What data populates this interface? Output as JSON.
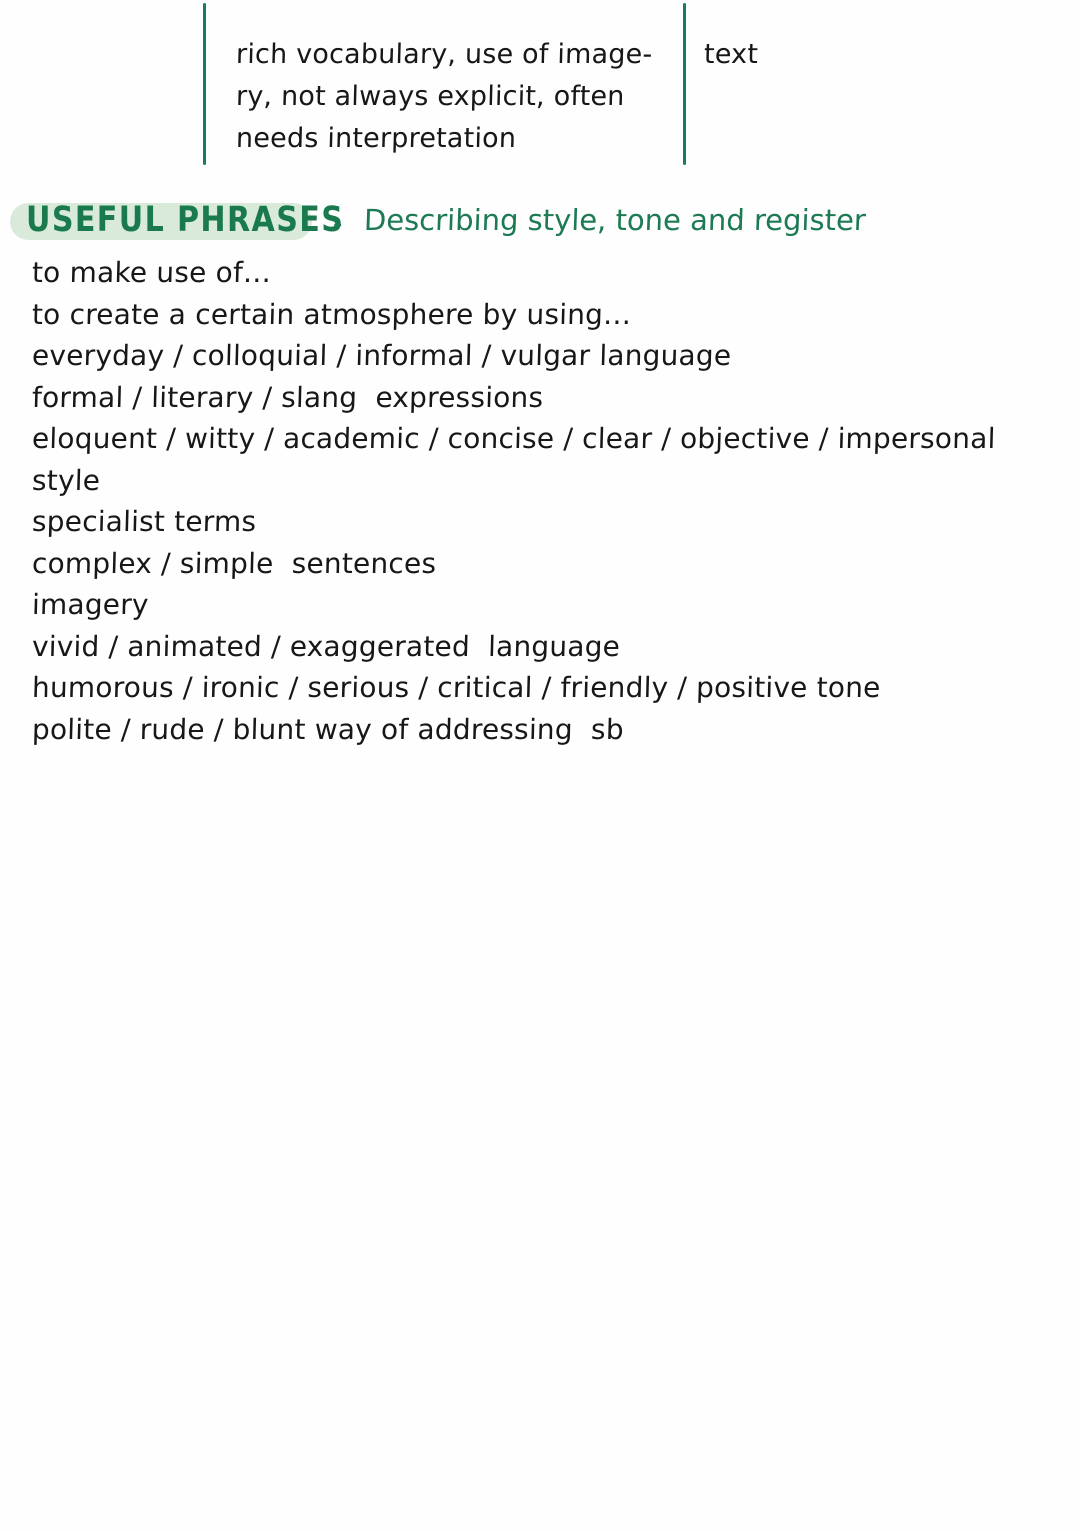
{
  "document": {
    "type": "handwritten study notes",
    "background_color": "#fefefe",
    "ink_color": "#171717",
    "accent_green": "#1d7a53",
    "rule_green": "#1a7a63",
    "highlight_green": "#d9eadb"
  },
  "table_fragment": {
    "left_cell": {
      "lines": [
        "rich vocabulary, use of image-",
        "ry, not always explicit, often",
        "needs interpretation"
      ]
    },
    "right_cell": {
      "lines": [
        "text"
      ]
    }
  },
  "section": {
    "title": "USEFUL PHRASES",
    "dash": "-",
    "subtitle": "Describing style, tone and register"
  },
  "phrases": [
    "to make use of…",
    "to create a certain atmosphere by using…",
    "everyday / colloquial / informal / vulgar language",
    "formal / literary / slang  expressions",
    "eloquent / witty / academic / concise / clear / objective / impersonal",
    "style",
    "specialist terms",
    "complex / simple  sentences",
    "imagery",
    "vivid / animated / exaggerated  language",
    "humorous / ironic / serious / critical / friendly / positive tone",
    "polite / rude / blunt way of addressing  sb"
  ]
}
